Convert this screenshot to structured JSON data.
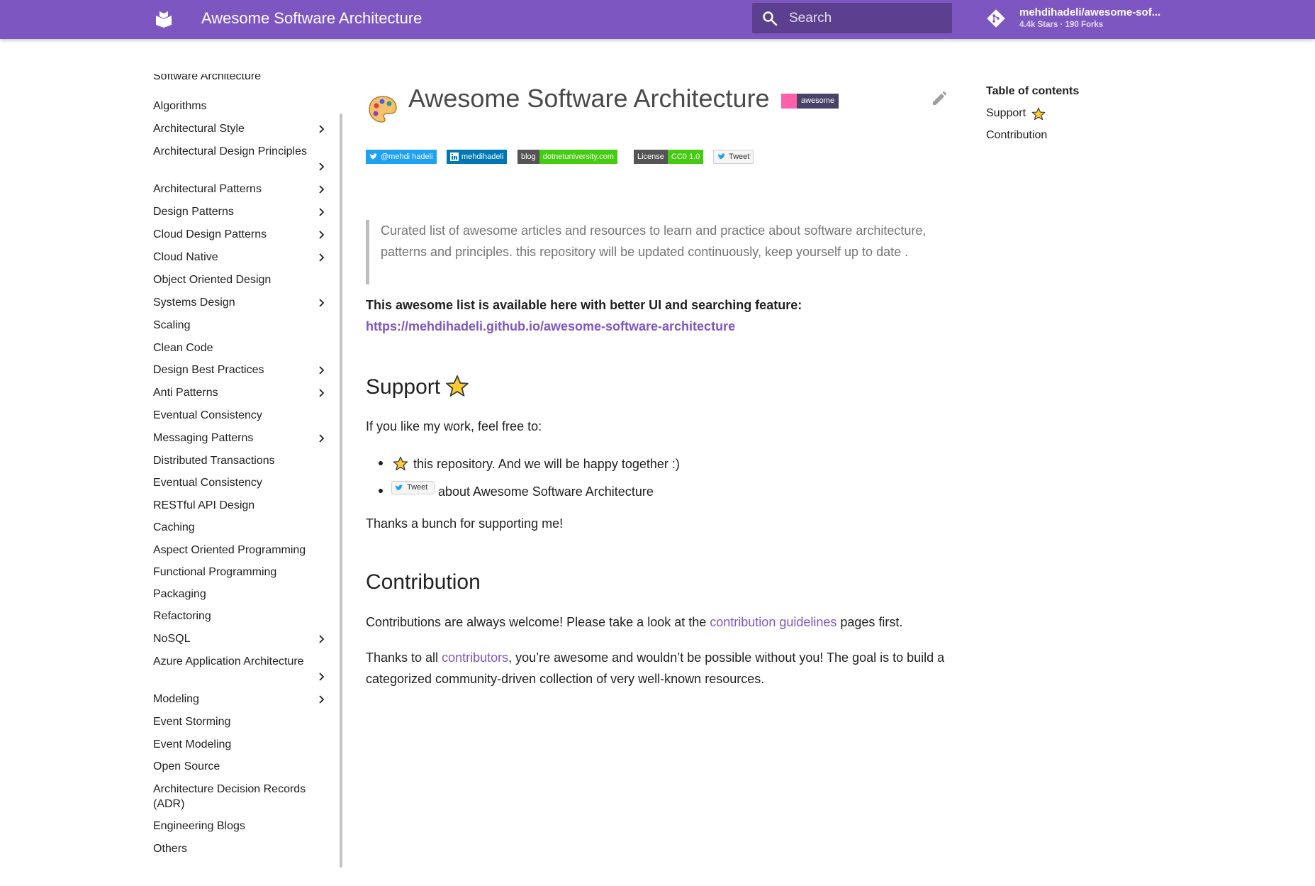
{
  "header": {
    "site_title": "Awesome Software Architecture",
    "search_placeholder": "Search",
    "repo_name": "mehdihadeli/awesome-sof...",
    "repo_facts": "4.4k Stars · 190 Forks",
    "color": "#7e56c2"
  },
  "sidebar": {
    "items": [
      {
        "label": "Software Architecture",
        "has_children": false
      },
      {
        "label": "Algorithms",
        "has_children": false
      },
      {
        "label": "Architectural Style",
        "has_children": true
      },
      {
        "label": "Architectural Design Principles",
        "has_children": true
      },
      {
        "label": "Architectural Patterns",
        "has_children": true
      },
      {
        "label": "Design Patterns",
        "has_children": true
      },
      {
        "label": "Cloud Design Patterns",
        "has_children": true
      },
      {
        "label": "Cloud Native",
        "has_children": true
      },
      {
        "label": "Object Oriented Design",
        "has_children": false
      },
      {
        "label": "Systems Design",
        "has_children": true
      },
      {
        "label": "Scaling",
        "has_children": false
      },
      {
        "label": "Clean Code",
        "has_children": false
      },
      {
        "label": "Design Best Practices",
        "has_children": true
      },
      {
        "label": "Anti Patterns",
        "has_children": true
      },
      {
        "label": "Eventual Consistency",
        "has_children": false
      },
      {
        "label": "Messaging Patterns",
        "has_children": true
      },
      {
        "label": "Distributed Transactions",
        "has_children": false
      },
      {
        "label": "Eventual Consistency",
        "has_children": false
      },
      {
        "label": "RESTful API Design",
        "has_children": false
      },
      {
        "label": "Caching",
        "has_children": false
      },
      {
        "label": "Aspect Oriented Programming",
        "has_children": false
      },
      {
        "label": "Functional Programming",
        "has_children": false
      },
      {
        "label": "Packaging",
        "has_children": false
      },
      {
        "label": "Refactoring",
        "has_children": false
      },
      {
        "label": "NoSQL",
        "has_children": true
      },
      {
        "label": "Azure Application Architecture",
        "has_children": true
      },
      {
        "label": "Modeling",
        "has_children": true
      },
      {
        "label": "Event Storming",
        "has_children": false
      },
      {
        "label": "Event Modeling",
        "has_children": false
      },
      {
        "label": "Open Source",
        "has_children": false
      },
      {
        "label": "Architecture Decision Records (ADR)",
        "has_children": false
      },
      {
        "label": "Engineering Blogs",
        "has_children": false
      },
      {
        "label": "Others",
        "has_children": false
      }
    ]
  },
  "main": {
    "title": "Awesome Software Architecture",
    "awesome_badge": "awesome",
    "badges": {
      "twitter": "@mehdi hadeli",
      "linkedin": "mehdihadeli",
      "blog_label": "blog",
      "blog_value": "dotnetuniversity.com",
      "license_label": "License",
      "license_value": "CC0 1.0",
      "tweet": "Tweet"
    },
    "quote": "Curated list of awesome articles and resources to learn and practice about software architecture, patterns and principles. this repository will be updated continuously, keep yourself up to date .",
    "available_text": "This awesome list is available here with better UI and searching feature:",
    "available_link": "https://mehdihadeli.github.io/awesome-software-architecture",
    "support": {
      "heading": "Support",
      "intro": "If you like my work, feel free to:",
      "bullet1": "this repository. And we will be happy together :)",
      "bullet2_tweet": "Tweet",
      "bullet2": "about Awesome Software Architecture",
      "thanks": "Thanks a bunch for supporting me!"
    },
    "contribution": {
      "heading": "Contribution",
      "p1_before": "Contributions are always welcome! Please take a look at the ",
      "p1_link": "contribution guidelines",
      "p1_after": " pages first.",
      "p2_before": "Thanks to all ",
      "p2_link": "contributors",
      "p2_after": ", you’re awesome and wouldn’t be possible without you! The goal is to build a categorized community-driven collection of very well-known resources."
    }
  },
  "toc": {
    "title": "Table of contents",
    "items": [
      "Support",
      "Contribution"
    ]
  }
}
